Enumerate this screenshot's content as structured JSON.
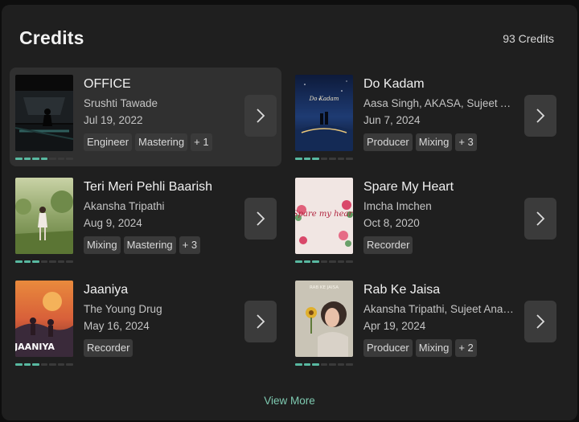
{
  "header": {
    "title": "Credits",
    "count": "93 Credits"
  },
  "credits": [
    {
      "name": "OFFICE",
      "artist": "Srushti Tawade",
      "date": "Jul 19, 2022",
      "tags": [
        "Engineer",
        "Mastering",
        "+ 1"
      ]
    },
    {
      "name": "Do Kadam",
      "artist": "Aasa Singh, AKASA, Sujeet Anahata",
      "date": "Jun 7, 2024",
      "tags": [
        "Producer",
        "Mixing",
        "+ 3"
      ],
      "cover_text": "Do Kadam"
    },
    {
      "name": "Teri Meri Pehli Baarish",
      "artist": "Akansha Tripathi",
      "date": "Aug 9, 2024",
      "tags": [
        "Mixing",
        "Mastering",
        "+ 3"
      ]
    },
    {
      "name": "Spare My Heart",
      "artist": "Imcha Imchen",
      "date": "Oct 8, 2020",
      "tags": [
        "Recorder"
      ],
      "cover_text": "Spare my heart"
    },
    {
      "name": "Jaaniya",
      "artist": "The Young Drug",
      "date": "May 16, 2024",
      "tags": [
        "Recorder"
      ],
      "cover_text": "JAANIYA"
    },
    {
      "name": "Rab Ke Jaisa",
      "artist": "Akansha Tripathi, Sujeet Anahata",
      "date": "Apr 19, 2024",
      "tags": [
        "Producer",
        "Mixing",
        "+ 2"
      ],
      "cover_text": "RAB KE JAISA"
    }
  ],
  "footer": {
    "view_more": "View More"
  },
  "colors": {
    "accent": "#7ec9b0",
    "progress": "#58b8a0",
    "panel": "#1f1f1f",
    "active_card": "#303030"
  }
}
